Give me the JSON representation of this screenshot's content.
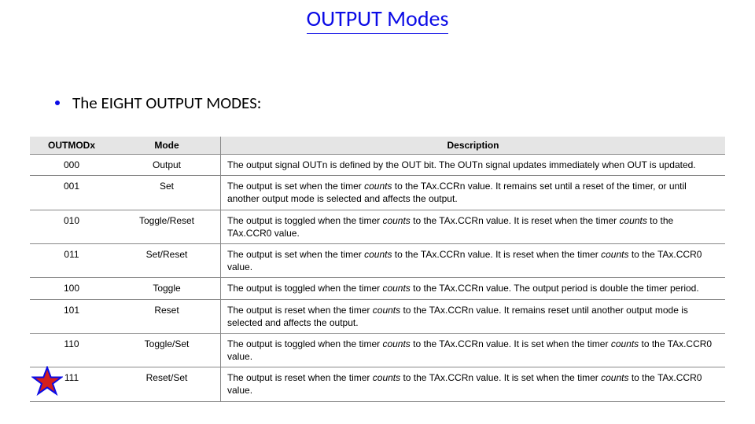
{
  "title": "OUTPUT Modes",
  "bullet": "The EIGHT OUTPUT MODES:",
  "table": {
    "headers": {
      "outmod": "OUTMODx",
      "mode": "Mode",
      "desc": "Description"
    },
    "rows": [
      {
        "code": "000",
        "mode": "Output",
        "desc_a": "The output signal OUTn is defined by the OUT bit. The OUTn signal updates immediately when OUT is updated."
      },
      {
        "code": "001",
        "mode": "Set",
        "desc_a": "The output is set when the timer ",
        "desc_em1": "counts",
        "desc_b": " to the TAx.CCRn value. It remains set until a reset of the timer, or until another output mode is selected and affects the output."
      },
      {
        "code": "010",
        "mode": "Toggle/Reset",
        "desc_a": "The output is toggled when the timer ",
        "desc_em1": "counts",
        "desc_b": " to the TAx.CCRn value. It is reset when the timer ",
        "desc_em2": "counts",
        "desc_c": " to the TAx.CCR0 value."
      },
      {
        "code": "011",
        "mode": "Set/Reset",
        "desc_a": "The output is set when the timer ",
        "desc_em1": "counts",
        "desc_b": " to the TAx.CCRn value. It is reset when the timer ",
        "desc_em2": "counts",
        "desc_c": " to the TAx.CCR0 value."
      },
      {
        "code": "100",
        "mode": "Toggle",
        "desc_a": "The output is toggled when the timer ",
        "desc_em1": "counts",
        "desc_b": " to the TAx.CCRn value. The output period is double the timer period."
      },
      {
        "code": "101",
        "mode": "Reset",
        "desc_a": "The output is reset when the timer ",
        "desc_em1": "counts",
        "desc_b": " to the TAx.CCRn value. It remains reset until another output mode is selected and affects the output."
      },
      {
        "code": "110",
        "mode": "Toggle/Set",
        "desc_a": "The output is toggled when the timer ",
        "desc_em1": "counts",
        "desc_b": " to the TAx.CCRn value. It is set when the timer ",
        "desc_em2": "counts",
        "desc_c": " to the TAx.CCR0 value."
      },
      {
        "code": "111",
        "mode": "Reset/Set",
        "desc_a": "The output is reset when the timer ",
        "desc_em1": "counts",
        "desc_b": " to the TAx.CCRn value. It is set when the timer ",
        "desc_em2": "counts",
        "desc_c": " to the TAx.CCR0 value."
      }
    ]
  },
  "star_icon": "star-icon"
}
